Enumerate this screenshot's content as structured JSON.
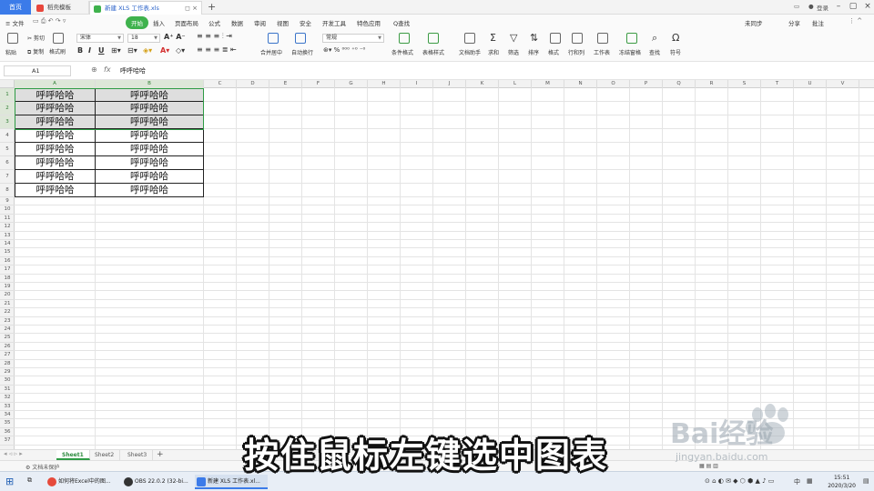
{
  "titlebar": {
    "home": "首页",
    "tabs": [
      {
        "label": "稻壳模板",
        "color": "#e8463b",
        "active": false
      },
      {
        "label": "新建 XLS 工作表.xls",
        "color": "#3fb24d",
        "active": true
      }
    ],
    "right_label": "登录"
  },
  "menubar": {
    "file": "≡ 文件",
    "items": [
      "开始",
      "插入",
      "页面布局",
      "公式",
      "数据",
      "审阅",
      "视图",
      "安全",
      "开发工具",
      "特色应用"
    ],
    "active": "开始",
    "search": "Q查找",
    "sync": "未同步",
    "share": "分享",
    "annotate": "批注"
  },
  "ribbon": {
    "paste": "粘贴",
    "cut": "剪切",
    "copy": "复制",
    "format_painter": "格式刷",
    "font_name": "宋体",
    "font_size": "18",
    "merge": "合并居中",
    "wrap": "自动换行",
    "number_format": "常规",
    "conditional": "条件格式",
    "table_style": "表格样式",
    "doc_helper": "文档助手",
    "sum": "求和",
    "filter": "筛选",
    "sort": "排序",
    "format": "格式",
    "rowcol": "行和列",
    "worksheet": "工作表",
    "freeze": "冻结窗格",
    "find": "查找",
    "symbol": "符号"
  },
  "formula_bar": {
    "name_box": "A1",
    "fx": "fx",
    "content": "呼呼哈哈"
  },
  "grid": {
    "columns": [
      "A",
      "B",
      "C",
      "D",
      "E",
      "F",
      "G",
      "H",
      "I",
      "J",
      "K",
      "L",
      "M",
      "N",
      "O",
      "P",
      "Q",
      "R",
      "S",
      "T",
      "U",
      "V"
    ],
    "rows": [
      "1",
      "2",
      "3",
      "4",
      "5",
      "6",
      "7",
      "8",
      "9",
      "10",
      "11",
      "12",
      "13",
      "14",
      "15",
      "16",
      "17",
      "18",
      "19",
      "20",
      "21",
      "22",
      "23",
      "24",
      "25",
      "26",
      "27",
      "28",
      "29",
      "30",
      "31",
      "32",
      "33",
      "34",
      "35",
      "36",
      "37"
    ],
    "data": [
      [
        "呼呼哈哈",
        "呼呼哈哈"
      ],
      [
        "呼呼哈哈",
        "呼呼哈哈"
      ],
      [
        "呼呼哈哈",
        "呼呼哈哈"
      ],
      [
        "呼呼哈哈",
        "呼呼哈哈"
      ],
      [
        "呼呼哈哈",
        "呼呼哈哈"
      ],
      [
        "呼呼哈哈",
        "呼呼哈哈"
      ],
      [
        "呼呼哈哈",
        "呼呼哈哈"
      ],
      [
        "呼呼哈哈",
        "呼呼哈哈"
      ]
    ],
    "selection": "A1:B3"
  },
  "sheets": {
    "tabs": [
      "Sheet1",
      "Sheet2",
      "Sheet3"
    ],
    "active": "Sheet1",
    "add": "+"
  },
  "status": {
    "protect": "文档未保护"
  },
  "taskbar": {
    "apps": [
      {
        "label": "如何将Excel中的图...",
        "color": "#e64a3b"
      },
      {
        "label": "OBS 22.0.2 (32-bi...",
        "color": "#333333"
      },
      {
        "label": "新建 XLS 工作表.xl...",
        "color": "#3b7be9"
      }
    ],
    "ime": "中",
    "time": "15:51",
    "date": "2020/3/20"
  },
  "caption": "按住鼠标左键选中图表",
  "watermark": {
    "brand": "Bai经验",
    "url": "jingyan.baidu.com"
  },
  "colors": {
    "accent": "#3fb24d",
    "selection": "#2e9b45",
    "home_tab": "#3b7be9"
  }
}
